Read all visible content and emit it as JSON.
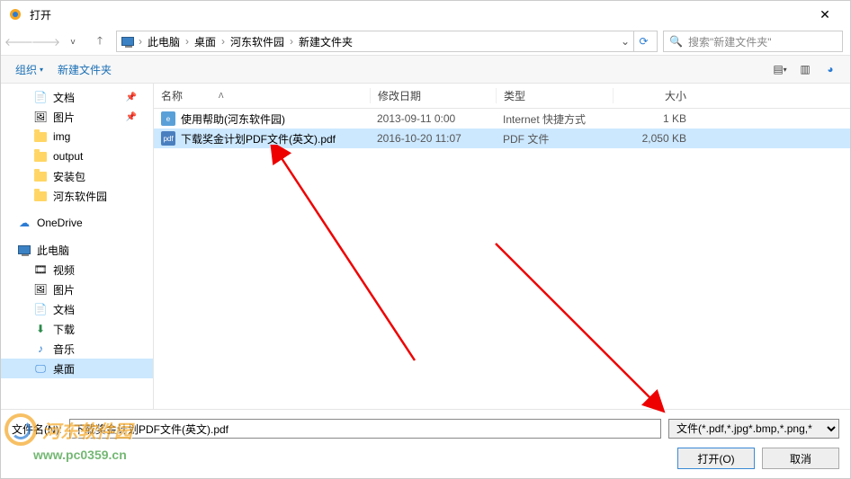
{
  "window": {
    "title": "打开",
    "close": "✕"
  },
  "nav": {
    "path": [
      "此电脑",
      "桌面",
      "河东软件园",
      "新建文件夹"
    ],
    "search_placeholder": "搜索\"新建文件夹\""
  },
  "toolbar": {
    "organize": "组织",
    "new_folder": "新建文件夹"
  },
  "sidebar": {
    "items": [
      {
        "label": "文档",
        "icon": "doc",
        "pin": true
      },
      {
        "label": "图片",
        "icon": "pic",
        "pin": true
      },
      {
        "label": "img",
        "icon": "folder"
      },
      {
        "label": "output",
        "icon": "folder"
      },
      {
        "label": "安装包",
        "icon": "folder"
      },
      {
        "label": "河东软件园",
        "icon": "folder"
      },
      {
        "label": "OneDrive",
        "icon": "onedrive",
        "top": true
      },
      {
        "label": "此电脑",
        "icon": "pc",
        "top": true
      },
      {
        "label": "视频",
        "icon": "video"
      },
      {
        "label": "图片",
        "icon": "pic"
      },
      {
        "label": "文档",
        "icon": "doc"
      },
      {
        "label": "下载",
        "icon": "download"
      },
      {
        "label": "音乐",
        "icon": "music"
      },
      {
        "label": "桌面",
        "icon": "desktop",
        "selected": true
      }
    ]
  },
  "columns": {
    "name": "名称",
    "date": "修改日期",
    "type": "类型",
    "size": "大小"
  },
  "files": [
    {
      "name": "使用帮助(河东软件园)",
      "date": "2013-09-11 0:00",
      "type": "Internet 快捷方式",
      "size": "1 KB",
      "icon": "url",
      "selected": false
    },
    {
      "name": "下载奖金计划PDF文件(英文).pdf",
      "date": "2016-10-20 11:07",
      "type": "PDF 文件",
      "size": "2,050 KB",
      "icon": "pdf",
      "selected": true
    }
  ],
  "footer": {
    "filename_label": "文件名(N):",
    "filename_value": "下载奖金计划PDF文件(英文).pdf",
    "filter": "文件(*.pdf,*.jpg*.bmp,*.png,*",
    "open": "打开(O)",
    "cancel": "取消"
  },
  "watermark": {
    "text": "河东软件园",
    "url": "www.pc0359.cn"
  }
}
